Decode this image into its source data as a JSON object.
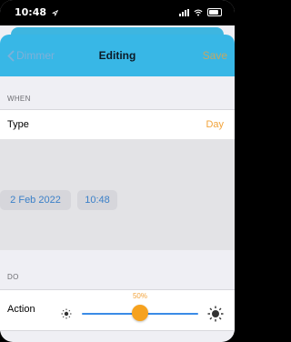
{
  "status_bar": {
    "time": "10:48"
  },
  "nav": {
    "back_label": "Dimmer",
    "title": "Editing",
    "save_label": "Save"
  },
  "when": {
    "header": "WHEN",
    "type_label": "Type",
    "type_value": "Day",
    "date": "2 Feb 2022",
    "time": "10:48"
  },
  "do": {
    "header": "DO",
    "action_label": "Action",
    "brightness_percent": "50%",
    "brightness_value": 0.5
  },
  "colors": {
    "accent": "#f2a33a",
    "nav": "#38b7e6",
    "slider": "#3a8be6"
  },
  "icons": [
    "location-arrow-icon",
    "signal-icon",
    "wifi-icon",
    "battery-icon",
    "chevron-left-icon",
    "sun-small-icon",
    "sun-large-icon"
  ]
}
